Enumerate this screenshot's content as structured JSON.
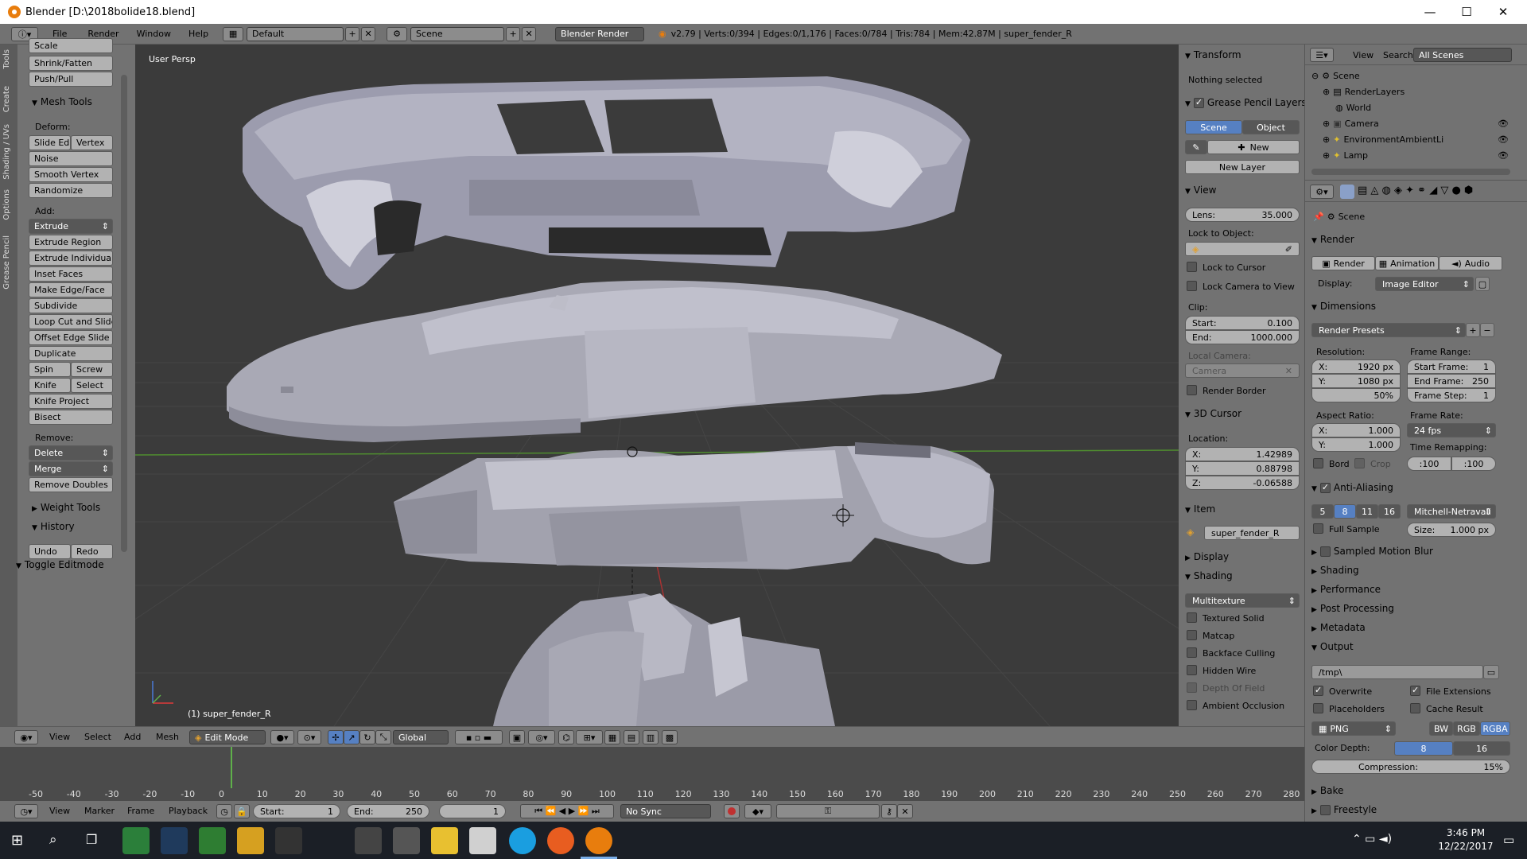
{
  "window": {
    "title": "Blender [D:\\2018bolide18.blend]",
    "minimize": "—",
    "maximize": "☐",
    "close": "✕"
  },
  "infobar": {
    "menus": [
      "File",
      "Render",
      "Window",
      "Help"
    ],
    "layout": "Default",
    "scene": "Scene",
    "engine": "Blender Render",
    "stats": "v2.79 | Verts:0/394 | Edges:0/1,176 | Faces:0/784 | Tris:784 | Mem:42.87M | super_fender_R"
  },
  "toolshelf": {
    "tabs": [
      "Tools",
      "Create",
      "Shading / UVs",
      "Options",
      "Grease Pencil"
    ],
    "top_items": [
      "Scale",
      "Shrink/Fatten",
      "Push/Pull"
    ],
    "mesh_tools_title": "Mesh Tools",
    "deform_label": "Deform:",
    "deform_row": [
      "Slide Ed",
      "Vertex"
    ],
    "deform_items": [
      "Noise",
      "Smooth Vertex",
      "Randomize"
    ],
    "add_label": "Add:",
    "extrude": "Extrude",
    "add_items": [
      "Extrude Region",
      "Extrude Individual",
      "Inset Faces",
      "Make Edge/Face",
      "Subdivide",
      "Loop Cut and Slide",
      "Offset Edge Slide",
      "Duplicate"
    ],
    "spin_row": [
      "Spin",
      "Screw"
    ],
    "knife_row": [
      "Knife",
      "Select"
    ],
    "knife_project": "Knife Project",
    "bisect": "Bisect",
    "remove_label": "Remove:",
    "delete": "Delete",
    "merge": "Merge",
    "remove_doubles": "Remove Doubles",
    "weight_tools": "Weight Tools",
    "history": "History",
    "undo": "Undo",
    "redo": "Redo",
    "toggle_editmode": "Toggle Editmode"
  },
  "viewport": {
    "view_label": "User Persp",
    "object_label": "(1) super_fender_R"
  },
  "props": {
    "transform": "Transform",
    "nothing_selected": "Nothing selected",
    "grease_pencil": "Grease Pencil Layers",
    "scene_btn": "Scene",
    "object_btn": "Object",
    "new_btn": "New",
    "new_layer": "New Layer",
    "view": "View",
    "lens_label": "Lens:",
    "lens_value": "35.000",
    "lock_to_object": "Lock to Object:",
    "lock_to_cursor": "Lock to Cursor",
    "lock_camera": "Lock Camera to View",
    "clip": "Clip:",
    "clip_start_label": "Start:",
    "clip_start": "0.100",
    "clip_end_label": "End:",
    "clip_end": "1000.000",
    "local_camera": "Local Camera:",
    "camera": "Camera",
    "render_border": "Render Border",
    "cursor": "3D Cursor",
    "location": "Location:",
    "x_label": "X:",
    "x": "1.42989",
    "y_label": "Y:",
    "y": "0.88798",
    "z_label": "Z:",
    "z": "-0.06588",
    "item": "Item",
    "item_name": "super_fender_R",
    "display": "Display",
    "shading": "Shading",
    "multitexture": "Multitexture",
    "shading_opts": [
      "Textured Solid",
      "Matcap",
      "Backface Culling",
      "Hidden Wire",
      "Depth Of Field",
      "Ambient Occlusion"
    ]
  },
  "outliner": {
    "menus": [
      "View",
      "Search"
    ],
    "filter": "All Scenes",
    "rows": [
      "Scene",
      "RenderLayers",
      "World",
      "Camera",
      "EnvironmentAmbientLi",
      "Lamp"
    ]
  },
  "render": {
    "context": "Scene",
    "render_panel": "Render",
    "render_btn": "Render",
    "animation_btn": "Animation",
    "audio_btn": "Audio",
    "display_label": "Display:",
    "display_value": "Image Editor",
    "dimensions": "Dimensions",
    "render_presets": "Render Presets",
    "resolution": "Resolution:",
    "res_x_label": "X:",
    "res_x": "1920 px",
    "res_y_label": "Y:",
    "res_y": "1080 px",
    "res_pct": "50%",
    "frame_range": "Frame Range:",
    "start_frame_label": "Start Frame:",
    "start_frame": "1",
    "end_frame_label": "End Frame:",
    "end_frame": "250",
    "frame_step_label": "Frame Step:",
    "frame_step": "1",
    "aspect": "Aspect Ratio:",
    "asp_x_label": "X:",
    "asp_x": "1.000",
    "asp_y_label": "Y:",
    "asp_y": "1.000",
    "frame_rate": "Frame Rate:",
    "fps": "24 fps",
    "time_remap": "Time Remapping:",
    "remap_old": ":100",
    "remap_new": ":100",
    "bord": "Bord",
    "crop": "Crop",
    "anti_aliasing": "Anti-Aliasing",
    "aa_samples": [
      "5",
      "8",
      "11",
      "16"
    ],
    "aa_filter": "Mitchell-Netravali",
    "full_sample": "Full Sample",
    "size_label": "Size:",
    "size": "1.000 px",
    "sampled_motion_blur": "Sampled Motion Blur",
    "shading": "Shading",
    "performance": "Performance",
    "post_processing": "Post Processing",
    "metadata": "Metadata",
    "output": "Output",
    "output_path": "/tmp\\",
    "overwrite": "Overwrite",
    "file_ext": "File Extensions",
    "placeholders": "Placeholders",
    "cache_result": "Cache Result",
    "format": "PNG",
    "bw": "BW",
    "rgb": "RGB",
    "rgba": "RGBA",
    "color_depth_label": "Color Depth:",
    "depth_8": "8",
    "depth_16": "16",
    "compression_label": "Compression:",
    "compression": "15%",
    "bake": "Bake",
    "freestyle": "Freestyle"
  },
  "v3dheader": {
    "menus": [
      "View",
      "Select",
      "Add",
      "Mesh"
    ],
    "mode": "Edit Mode",
    "orientation": "Global"
  },
  "timeline": {
    "ticks": [
      "-50",
      "-40",
      "-30",
      "-20",
      "-10",
      "0",
      "10",
      "20",
      "30",
      "40",
      "50",
      "60",
      "70",
      "80",
      "90",
      "100",
      "110",
      "120",
      "130",
      "140",
      "150",
      "160",
      "170",
      "180",
      "190",
      "200",
      "210",
      "220",
      "230",
      "240",
      "250",
      "260",
      "270",
      "280"
    ],
    "menus": [
      "View",
      "Marker",
      "Frame",
      "Playback"
    ],
    "start_label": "Start:",
    "start": "1",
    "end_label": "End:",
    "end": "250",
    "current": "1",
    "sync": "No Sync"
  },
  "taskbar": {
    "time": "3:46 PM",
    "date": "12/22/2017"
  }
}
